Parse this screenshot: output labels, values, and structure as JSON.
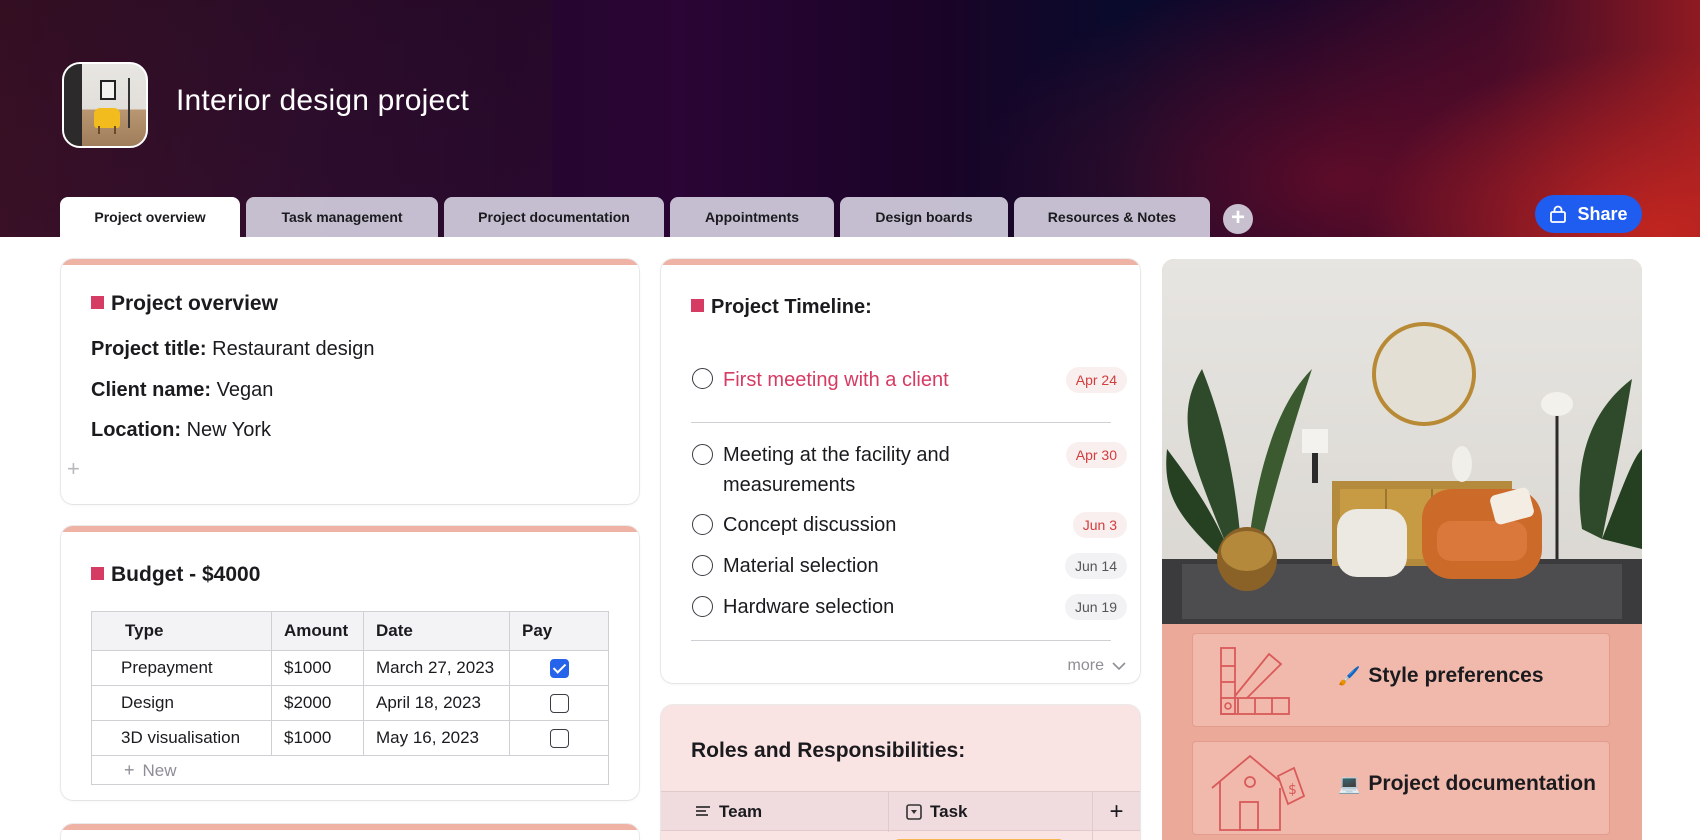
{
  "header": {
    "title": "Interior design project",
    "share_label": "Share",
    "add_tab_symbol": "+"
  },
  "tabs": [
    {
      "label": "Project overview",
      "active": true
    },
    {
      "label": "Task management",
      "active": false
    },
    {
      "label": "Project documentation",
      "active": false
    },
    {
      "label": "Appointments",
      "active": false
    },
    {
      "label": "Design boards",
      "active": false
    },
    {
      "label": "Resources & Notes",
      "active": false
    }
  ],
  "overview": {
    "title": "Project overview",
    "fields": [
      {
        "label": "Project title:",
        "value": "Restaurant design"
      },
      {
        "label": "Client name:",
        "value": "Vegan"
      },
      {
        "label": "Location:",
        "value": "New York"
      }
    ],
    "add_symbol": "+"
  },
  "budget": {
    "title": "Budget - $4000",
    "columns": [
      "Type",
      "Amount",
      "Date",
      "Pay"
    ],
    "rows": [
      {
        "type": "Prepayment",
        "amount": "$1000",
        "date": "March 27, 2023",
        "paid": true
      },
      {
        "type": "Design",
        "amount": "$2000",
        "date": "April 18, 2023",
        "paid": false
      },
      {
        "type": "3D visualisation",
        "amount": "$1000",
        "date": "May 16, 2023",
        "paid": false
      }
    ],
    "new_label": "New"
  },
  "timeline": {
    "title": "Project Timeline:",
    "items": [
      {
        "text": "First meeting with a client",
        "date": "Apr 24",
        "highlight": true
      },
      {
        "text": "Meeting at the facility and measurements",
        "date": "Apr 30"
      },
      {
        "text": "Concept discussion",
        "date": "Jun 3"
      },
      {
        "text": "Material selection",
        "date": "Jun 14"
      },
      {
        "text": "Hardware selection",
        "date": "Jun 19"
      }
    ],
    "more_label": "more"
  },
  "roles": {
    "title": "Roles and Responsibilities:",
    "columns": [
      "Team",
      "Task"
    ],
    "add_symbol": "+"
  },
  "links": [
    {
      "emoji": "🖌️",
      "label": "Style preferences",
      "icon": "color-swatch-icon"
    },
    {
      "emoji": "💻",
      "label": "Project documentation",
      "icon": "house-price-icon"
    }
  ],
  "colors": {
    "accent_square": "#d63b63",
    "share_button": "#1f5cf0",
    "card_topbar": "#efb3a6",
    "tile_bg": "#f1b9ab"
  }
}
